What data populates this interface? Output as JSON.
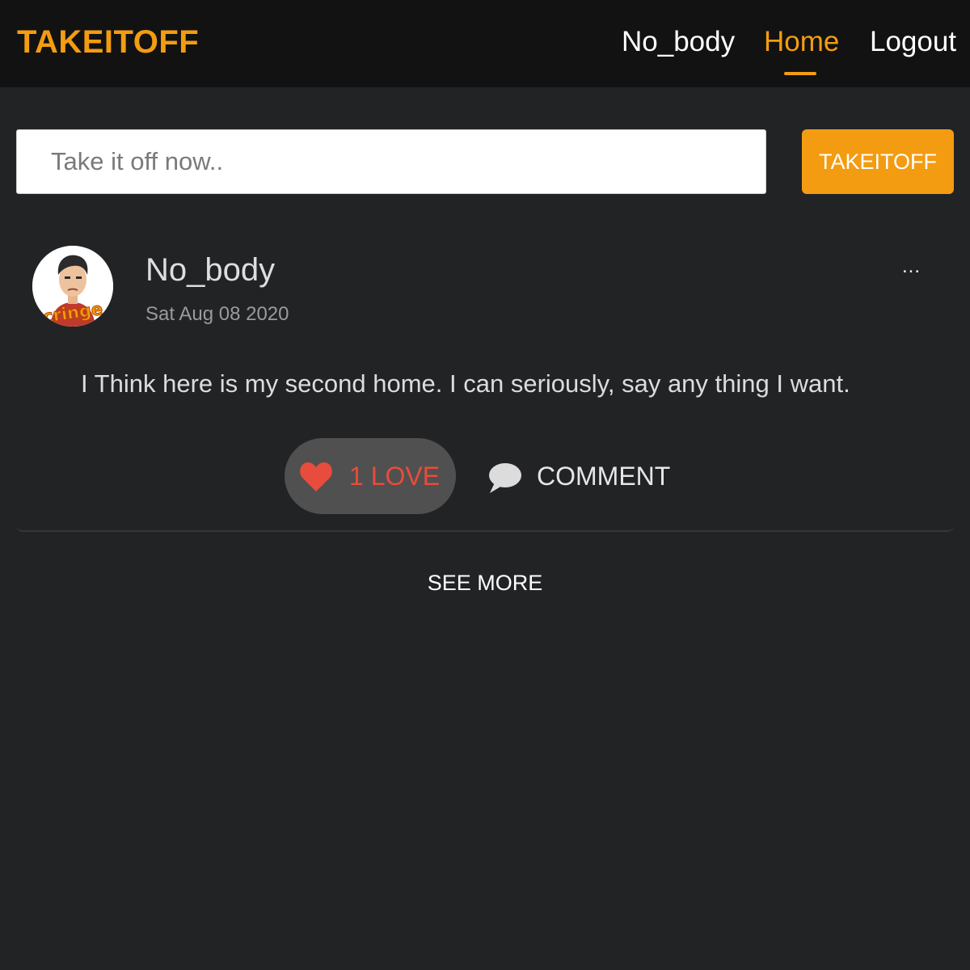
{
  "navbar": {
    "brand": "TAKEITOFF",
    "user_link": "No_body",
    "home_link": "Home",
    "logout_link": "Logout",
    "active": "Home"
  },
  "composer": {
    "placeholder": "Take it off now..",
    "value": "",
    "submit_label": "TAKEITOFF"
  },
  "post": {
    "author": "No_body",
    "date": "Sat Aug 08 2020",
    "more_label": "...",
    "text": "I Think here is my second home. I can seriously, say any thing I want.",
    "love_label": "1 LOVE",
    "comment_label": "COMMENT",
    "avatar_sticker_text": "cringe"
  },
  "see_more_label": "SEE MORE",
  "icons": {
    "love": "heart-icon",
    "comment": "speech-bubble-icon",
    "menu": "ellipsis-icon"
  },
  "colors": {
    "accent": "#f39c12",
    "background": "#222325",
    "navbar": "#121212",
    "love": "#e74c3c"
  }
}
